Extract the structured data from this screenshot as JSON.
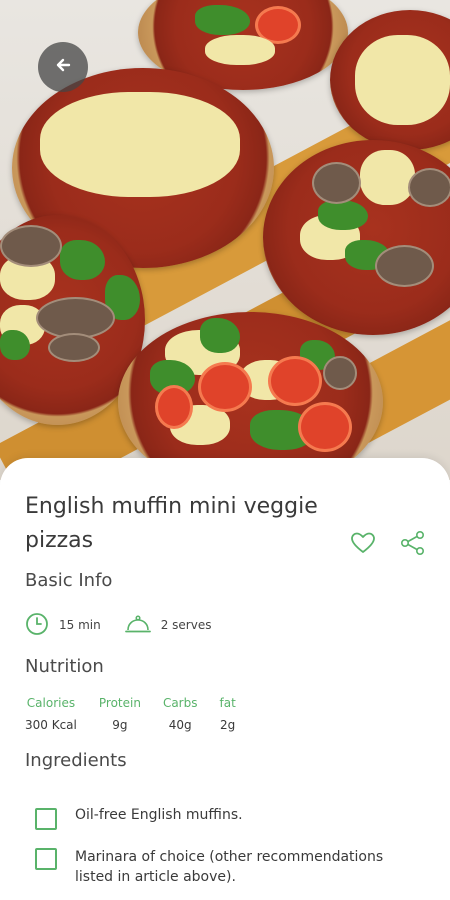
{
  "recipe": {
    "title": "English muffin mini veggie pizzas"
  },
  "basic_info": {
    "heading": "Basic Info",
    "time": "15 min",
    "serves": "2 serves"
  },
  "nutrition": {
    "heading": "Nutrition",
    "items": [
      {
        "label": "Calories",
        "value": "300 Kcal"
      },
      {
        "label": "Protein",
        "value": "9g"
      },
      {
        "label": "Carbs",
        "value": "40g"
      },
      {
        "label": "fat",
        "value": "2g"
      }
    ]
  },
  "ingredients": {
    "heading": "Ingredients",
    "items": [
      "Oil-free English muffins.",
      "Marinara of choice (other recommendations listed in article above)."
    ]
  },
  "colors": {
    "accent": "#59b36a",
    "text": "#3a3a3a"
  },
  "icons": {
    "back": "back-arrow-icon",
    "favorite": "heart-icon",
    "share": "share-icon",
    "time": "clock-icon",
    "serves": "cloche-icon"
  }
}
